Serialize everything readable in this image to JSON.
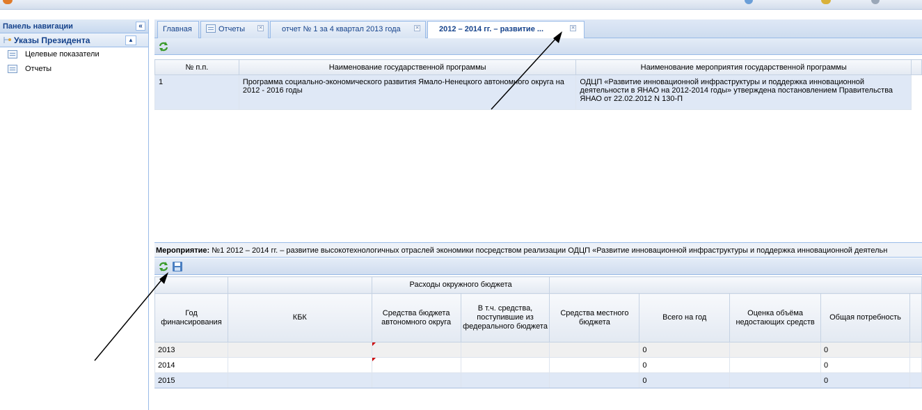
{
  "sidebar": {
    "header": "Панель навигации",
    "group": "Указы Президента",
    "items": [
      {
        "label": "Целевые показатели"
      },
      {
        "label": "Отчеты"
      }
    ]
  },
  "tabs": [
    {
      "label": "Главная"
    },
    {
      "label": "Отчеты"
    },
    {
      "label": "отчет № 1 за 4 квартал 2013 года"
    },
    {
      "label": "2012 – 2014 гг. – развитие ..."
    }
  ],
  "programs_grid": {
    "columns": [
      "№ п.п.",
      "Наименование государственной программы",
      "Наименование мероприятия государственной программы"
    ],
    "rows": [
      {
        "num": "1",
        "program": "Программа социально-экономического развития Ямало-Ненецкого автономного округа на 2012 - 2016 годы",
        "event": "ОДЦП «Развитие инновационной инфраструктуры и поддержка инновационной деятельности в ЯНАО на 2012-2014 годы» утверждена постановлением Правительства ЯНАО от 22.02.2012 N 130-П"
      }
    ]
  },
  "event_bar": {
    "label": "Мероприятие:",
    "value": "№1 2012 – 2014 гг. – развитие высокотехнологичных отраслей экономики посредством реализации ОДЦП «Развитие инновационной инфраструктуры и поддержка инновационной деятельн"
  },
  "finance_grid": {
    "group_header": "Расходы окружного бюджета",
    "columns": [
      "Год финансирования",
      "КБК",
      "Средства бюджета автономного округа",
      "В т.ч. средства, поступившие из федерального бюджета",
      "Средства местного бюджета",
      "Всего на год",
      "Оценка объёма недостающих средств",
      "Общая потребность"
    ],
    "rows": [
      {
        "year": "2013",
        "total": "0",
        "need": "0"
      },
      {
        "year": "2014",
        "total": "0",
        "need": "0"
      },
      {
        "year": "2015",
        "total": "0",
        "need": "0"
      }
    ]
  },
  "colors": {
    "accent": "#15428b",
    "header_bg": "#dfe8f6",
    "border": "#99bbe8"
  }
}
